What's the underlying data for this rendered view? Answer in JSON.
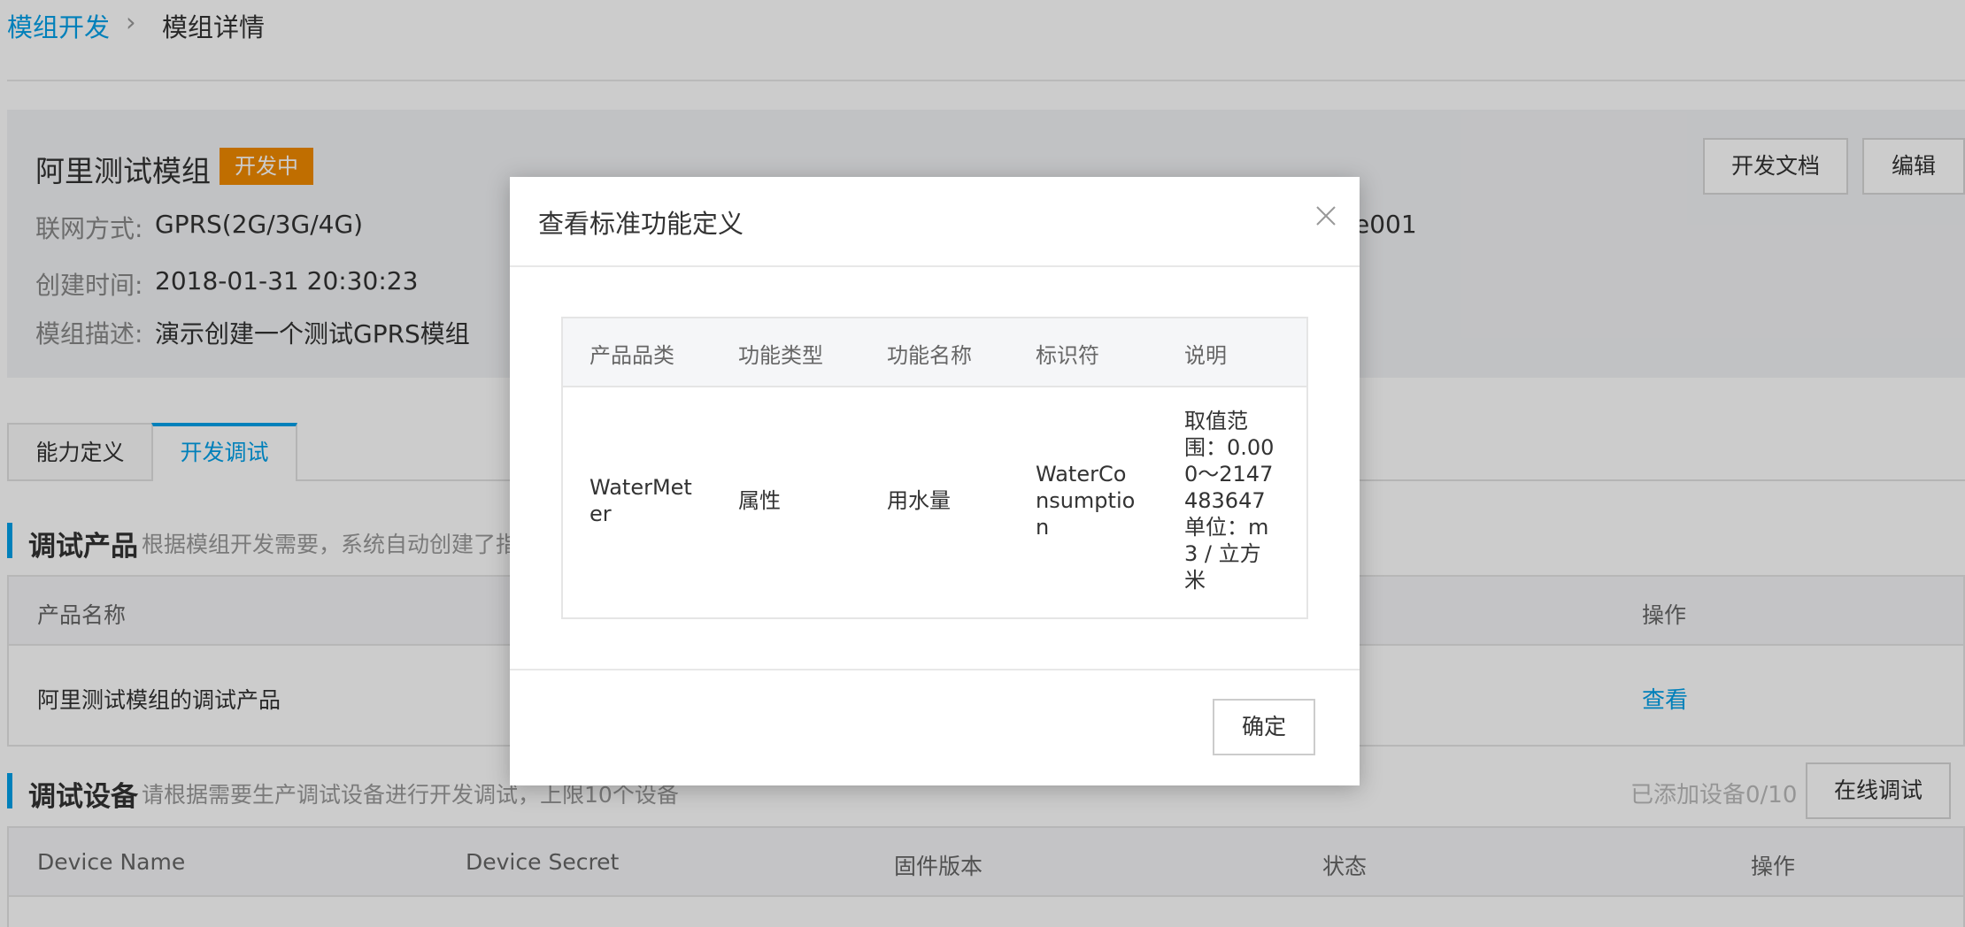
{
  "breadcrumb": {
    "parent": "模组开发",
    "separator": "›",
    "current": "模组详情"
  },
  "module": {
    "name": "阿里测试模组",
    "status_badge": "开发中",
    "network_label": "联网方式:",
    "network_value": "GPRS(2G/3G/4G)",
    "created_label": "创建时间:",
    "created_value": "2018-01-31 20:30:23",
    "desc_label": "模组描述:",
    "desc_value": "演示创建一个测试GPRS模组",
    "partial_value": "e001",
    "doc_button": "开发文档",
    "edit_button": "编辑"
  },
  "tabs": [
    {
      "label": "能力定义"
    },
    {
      "label": "开发调试"
    }
  ],
  "debug_product": {
    "title": "调试产品",
    "subtitle": "根据模组开发需要，系统自动创建了指定",
    "headers": {
      "name": "产品名称",
      "action": "操作"
    },
    "row": {
      "name": "阿里测试模组的调试产品",
      "action": "查看"
    }
  },
  "debug_device": {
    "title": "调试设备",
    "subtitle": "请根据需要生产调试设备进行开发调试，上限10个设备",
    "count": "已添加设备0/10",
    "online_button": "在线调试",
    "headers": [
      "Device Name",
      "Device Secret",
      "固件版本",
      "状态",
      "操作"
    ]
  },
  "modal": {
    "title": "查看标准功能定义",
    "headers": [
      "产品品类",
      "功能类型",
      "功能名称",
      "标识符",
      "说明"
    ],
    "row": {
      "category": [
        "WaterMet",
        "er"
      ],
      "type": "属性",
      "name": "用水量",
      "identifier": [
        "WaterCo",
        "nsumptio",
        "n"
      ],
      "description": [
        "取值范",
        "围：0.00",
        "0～2147",
        "483647",
        "单位：m",
        "3 / 立方",
        "米"
      ]
    },
    "ok_button": "确定"
  }
}
